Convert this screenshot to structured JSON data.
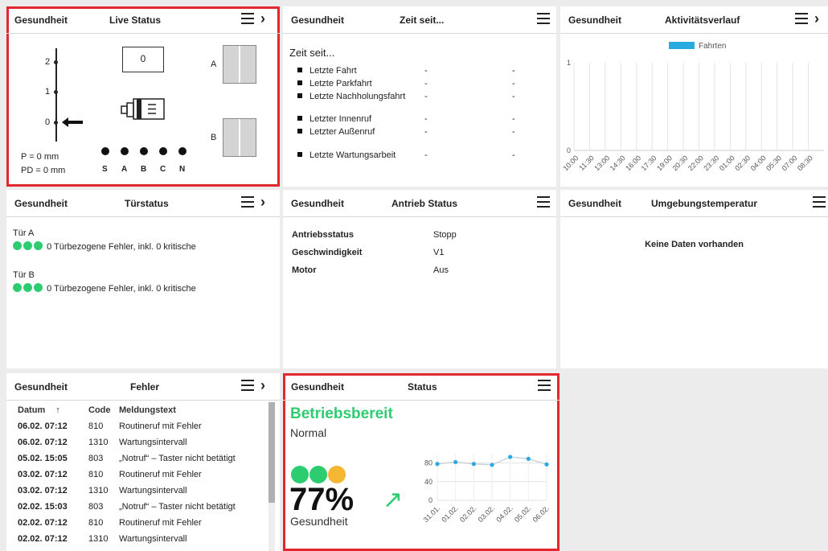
{
  "colors": {
    "highlight": "#e0282e",
    "green": "#2ecc71",
    "amber": "#f5b731",
    "chart_blue": "#29abe2"
  },
  "cards": {
    "live": {
      "section": "Gesundheit",
      "title": "Live Status"
    },
    "zeit": {
      "section": "Gesundheit",
      "title": "Zeit seit..."
    },
    "aktiv": {
      "section": "Gesundheit",
      "title": "Aktivitätsverlauf"
    },
    "tuer": {
      "section": "Gesundheit",
      "title": "Türstatus"
    },
    "antrieb": {
      "section": "Gesundheit",
      "title": "Antrieb Status"
    },
    "umgebung": {
      "section": "Gesundheit",
      "title": "Umgebungstemperatur"
    },
    "fehler": {
      "section": "Gesundheit",
      "title": "Fehler"
    },
    "status": {
      "section": "Gesundheit",
      "title": "Status"
    }
  },
  "live": {
    "floors": [
      "2",
      "1",
      "0"
    ],
    "counter": "0",
    "door_a": "A",
    "door_b": "B",
    "p": "P = 0 mm",
    "pd": "PD = 0 mm",
    "lights": [
      "S",
      "A",
      "B",
      "C",
      "N"
    ]
  },
  "zeit": {
    "heading": "Zeit seit...",
    "rows": [
      {
        "label": "Letzte Fahrt",
        "v1": "-",
        "v2": "-"
      },
      {
        "label": "Letzte Parkfahrt",
        "v1": "-",
        "v2": "-"
      },
      {
        "label": "Letzte Nachholungsfahrt",
        "v1": "-",
        "v2": "-"
      },
      {
        "label": "Letzter Innenruf",
        "v1": "-",
        "v2": "-"
      },
      {
        "label": "Letzter Außenruf",
        "v1": "-",
        "v2": "-"
      },
      {
        "label": "Letzte Wartungsarbeit",
        "v1": "-",
        "v2": "-"
      }
    ]
  },
  "tuer": {
    "doors": [
      {
        "name": "Tür A",
        "text": "0 Türbezogene Fehler, inkl. 0 kritische"
      },
      {
        "name": "Tür B",
        "text": "0 Türbezogene Fehler, inkl. 0 kritische"
      }
    ]
  },
  "antrieb": {
    "rows": [
      {
        "key": "Antriebsstatus",
        "value": "Stopp"
      },
      {
        "key": "Geschwindigkeit",
        "value": "V1"
      },
      {
        "key": "Motor",
        "value": "Aus"
      }
    ]
  },
  "umgebung": {
    "empty": "Keine Daten vorhanden"
  },
  "fehler": {
    "columns": [
      "Datum",
      "Code",
      "Meldungstext"
    ],
    "sort_icon": "↑",
    "rows": [
      {
        "date": "06.02. 07:12",
        "code": "810",
        "text": "Routineruf mit Fehler"
      },
      {
        "date": "06.02. 07:12",
        "code": "1310",
        "text": "Wartungsintervall"
      },
      {
        "date": "05.02. 15:05",
        "code": "803",
        "text": "„Notruf“ – Taster nicht betätigt"
      },
      {
        "date": "03.02. 07:12",
        "code": "810",
        "text": "Routineruf mit Fehler"
      },
      {
        "date": "03.02. 07:12",
        "code": "1310",
        "text": "Wartungsintervall"
      },
      {
        "date": "02.02. 15:03",
        "code": "803",
        "text": "„Notruf“ – Taster nicht betätigt"
      },
      {
        "date": "02.02. 07:12",
        "code": "810",
        "text": "Routineruf mit Fehler"
      },
      {
        "date": "02.02. 07:12",
        "code": "1310",
        "text": "Wartungsintervall"
      }
    ]
  },
  "status": {
    "state": "Betriebsbereit",
    "sub": "Normal",
    "percent": "77%",
    "label": "Gesundheit",
    "trend_icon": "↗"
  },
  "chart_data": [
    {
      "type": "bar",
      "title": "",
      "legend": [
        "Fahrten"
      ],
      "legend_placement": "top",
      "categories": [
        "10:00",
        "11:30",
        "13:00",
        "14:30",
        "16:00",
        "17:30",
        "19:00",
        "20:30",
        "22:00",
        "23:30",
        "01:00",
        "02:30",
        "04:00",
        "05:30",
        "07:00",
        "08:30"
      ],
      "series": [
        {
          "name": "Fahrten",
          "values": [
            0,
            0,
            0,
            0,
            0,
            0,
            0,
            0,
            0,
            0,
            0,
            0,
            0,
            0,
            0,
            0
          ]
        }
      ],
      "yticks": [
        "0",
        "1"
      ],
      "ylim": [
        0,
        1
      ],
      "grid": true
    },
    {
      "type": "line",
      "title": "",
      "categories": [
        "31.01.",
        "01.02.",
        "02.02.",
        "03.02.",
        "04.02.",
        "05.02.",
        "06.02."
      ],
      "series": [
        {
          "values": [
            78,
            82,
            78,
            76,
            93,
            89,
            77
          ]
        }
      ],
      "yticks": [
        "0",
        "40",
        "80"
      ],
      "ylim": [
        0,
        100
      ],
      "grid": true
    }
  ]
}
